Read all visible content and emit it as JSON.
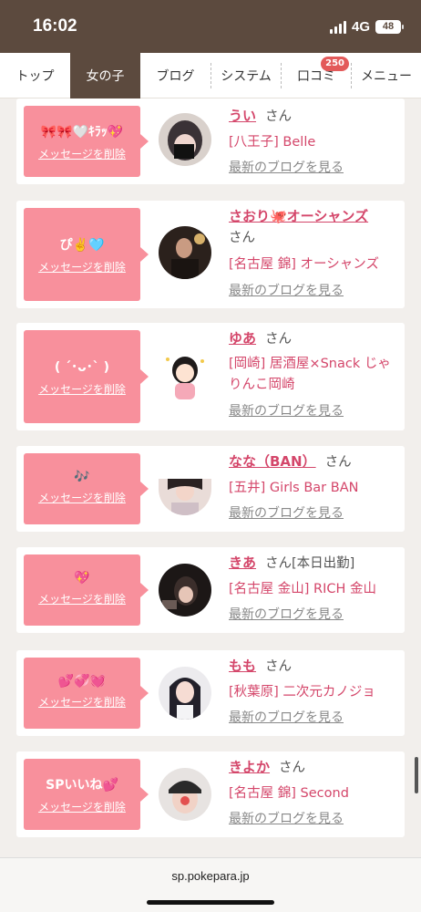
{
  "status_bar": {
    "time": "16:02",
    "network": "4G",
    "battery": "48"
  },
  "nav": {
    "tabs": [
      {
        "label": "トップ"
      },
      {
        "label": "女の子"
      },
      {
        "label": "ブログ"
      },
      {
        "label": "システム"
      },
      {
        "label": "口コミ",
        "badge": "250"
      },
      {
        "label": "メニュー"
      }
    ]
  },
  "cards": [
    {
      "message": "🎀🎀🤍ｷﾗｯ💖",
      "delete_label": "メッセージを削除",
      "name": "うい",
      "honorific": "さん",
      "shop": "[八王子] Belle",
      "blog_link": "最新のブログを見る"
    },
    {
      "message": "ぴ✌️🩵",
      "delete_label": "メッセージを削除",
      "name": "さおり🐙オーシャンズ",
      "honorific": "さん",
      "shop": "[名古屋 錦] オーシャンズ",
      "blog_link": "最新のブログを見る"
    },
    {
      "message": "( ´･ᴗ･` )",
      "delete_label": "メッセージを削除",
      "name": "ゆあ",
      "honorific": "さん",
      "shop": "[岡崎] 居酒屋×Snack じゃりんこ岡崎",
      "blog_link": "最新のブログを見る"
    },
    {
      "message": "🎶",
      "delete_label": "メッセージを削除",
      "name": "なな（BAN）",
      "honorific": "さん",
      "shop": "[五井] Girls Bar BAN",
      "blog_link": "最新のブログを見る"
    },
    {
      "message": "💖",
      "delete_label": "メッセージを削除",
      "name": "きあ",
      "honorific": "さん[本日出勤]",
      "shop": "[名古屋 金山] RICH 金山",
      "blog_link": "最新のブログを見る"
    },
    {
      "message": "💕💞💓",
      "delete_label": "メッセージを削除",
      "name": "もも",
      "honorific": "さん",
      "shop": "[秋葉原] 二次元カノジョ",
      "blog_link": "最新のブログを見る"
    },
    {
      "message": "SPいいね💕",
      "delete_label": "メッセージを削除",
      "name": "きよか",
      "honorific": "さん",
      "shop": "[名古屋 錦] Second",
      "blog_link": "最新のブログを見る"
    }
  ],
  "footer": {
    "url": "sp.pokepara.jp"
  }
}
